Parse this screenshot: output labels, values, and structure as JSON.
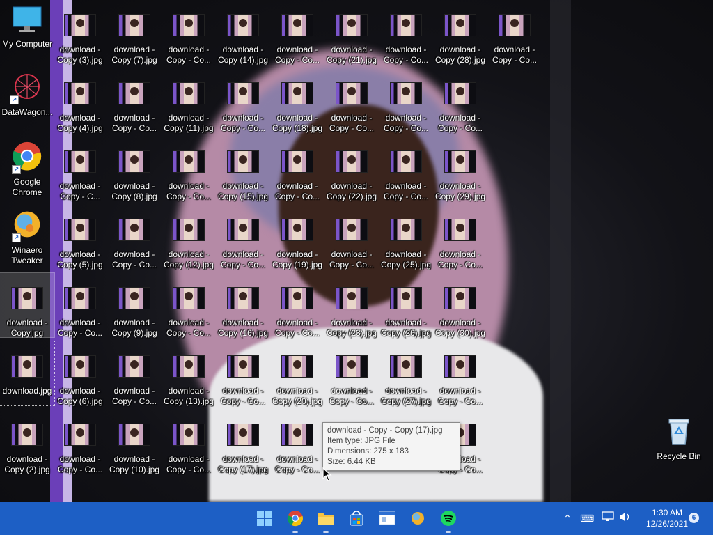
{
  "desktop": {
    "columns": [
      [
        "My Computer",
        "DataWagon...",
        "Google Chrome",
        "Winaero Tweaker",
        "download - Copy.jpg",
        "download.jpg",
        "download - Copy (2).jpg"
      ],
      [
        "download - Copy (3).jpg",
        "download - Copy (4).jpg",
        "download - Copy - C...",
        "download - Copy (5).jpg",
        "download - Copy - Co...",
        "download - Copy (6).jpg",
        "download - Copy - Co..."
      ],
      [
        "download - Copy (7).jpg",
        "download - Copy - Co...",
        "download - Copy (8).jpg",
        "download - Copy - Co...",
        "download - Copy (9).jpg",
        "download - Copy - Co...",
        "download - Copy (10).jpg"
      ],
      [
        "download - Copy - Co...",
        "download - Copy (11).jpg",
        "download - Copy - Co...",
        "download - Copy (12).jpg",
        "download - Copy - Co...",
        "download - Copy (13).jpg",
        "download - Copy - Co..."
      ],
      [
        "download - Copy (14).jpg",
        "download - Copy - Co...",
        "download - Copy (15).jpg",
        "download - Copy - Co...",
        "download - Copy (16).jpg",
        "download - Copy - Co...",
        "download - Copy (17).jpg"
      ],
      [
        "download - Copy - Co...",
        "download - Copy (18).jpg",
        "download - Copy - Co...",
        "download - Copy (19).jpg",
        "download - Copy - Co...",
        "download - Copy (20).jpg",
        "download - Copy - Co..."
      ],
      [
        "download - Copy (21).jpg",
        "download - Copy - Co...",
        "download - Copy (22).jpg",
        "download - Copy - Co...",
        "download - Copy (23).jpg",
        "download - Copy - Co...",
        ""
      ],
      [
        "download - Copy - Co...",
        "download - Copy - Co...",
        "download - Copy - Co...",
        "download - Copy (25).jpg",
        "download - Copy (26).jpg",
        "download - Copy (27).jpg",
        ""
      ],
      [
        "download - Copy (28).jpg",
        "download - Copy - Co...",
        "download - Copy (29).jpg",
        "download - Copy - Co...",
        "download - Copy (30).jpg",
        "download - Copy - Co...",
        "download - Copy - Co..."
      ],
      [
        "download - Copy - Co...",
        "",
        "",
        "",
        "",
        "",
        ""
      ]
    ],
    "recycle_bin": "Recycle Bin"
  },
  "tooltip": {
    "name": "download - Copy - Copy (17).jpg",
    "type": "Item type: JPG File",
    "dimensions": "Dimensions: 275 x 183",
    "size": "Size: 6.44 KB"
  },
  "taskbar": {
    "apps": [
      "start-icon",
      "chrome-icon",
      "file-explorer-icon",
      "store-icon",
      "window-icon",
      "winaero-icon",
      "spotify-icon"
    ],
    "clock_time": "1:30 AM",
    "clock_date": "12/26/2021",
    "notification_count": "6"
  }
}
